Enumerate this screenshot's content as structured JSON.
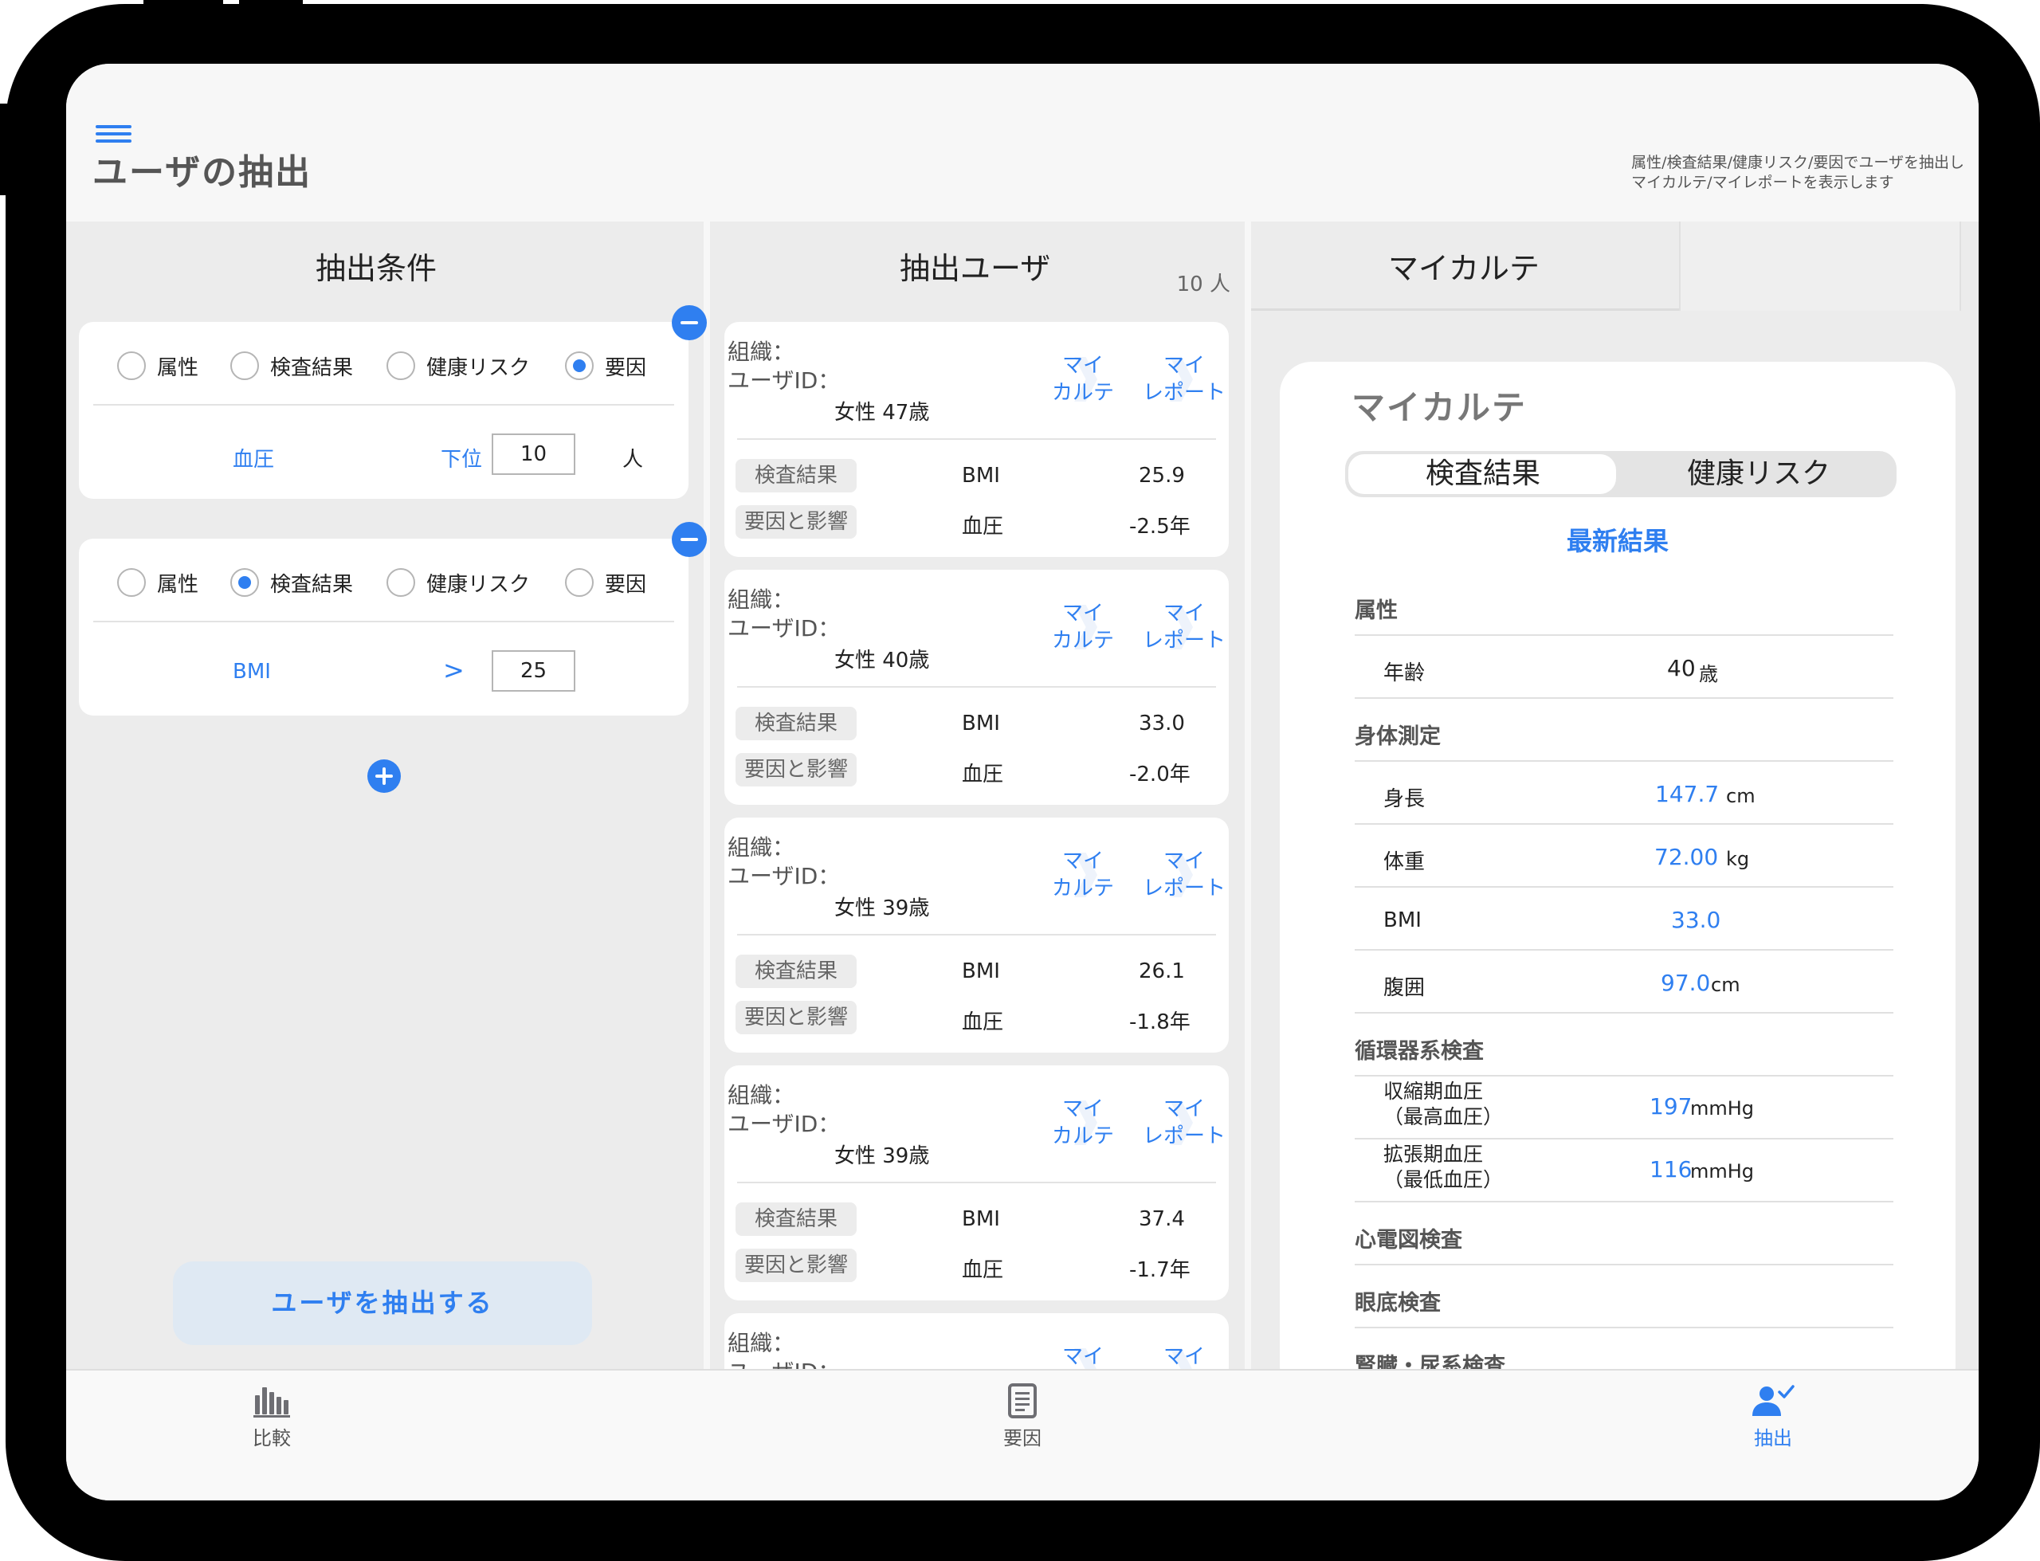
{
  "header": {
    "title": "ユーザの抽出",
    "description_line1": "属性/検査結果/健康リスク/要因でユーザを抽出し",
    "description_line2": "マイカルテ/マイレポートを表示します"
  },
  "conditions": {
    "title": "抽出条件",
    "radio_labels": [
      "属性",
      "検査結果",
      "健康リスク",
      "要因"
    ],
    "card1": {
      "selected": "要因",
      "item": "血圧",
      "operator": "下位",
      "value": "10",
      "unit": "人"
    },
    "card2": {
      "selected": "検査結果",
      "item": "BMI",
      "operator": ">",
      "value": "25"
    },
    "extract_button": "ユーザを抽出する"
  },
  "users": {
    "title": "抽出ユーザ",
    "count": "10 人",
    "org_label": "組織：",
    "id_label": "ユーザID：",
    "my_karte": [
      "マイ",
      "カルテ"
    ],
    "my_report": [
      "マイ",
      "レポート"
    ],
    "tag_result": "検査結果",
    "tag_factor": "要因と影響",
    "list": [
      {
        "attr": "女性  47歳",
        "metric": "BMI",
        "value": "25.9",
        "factor": "血圧",
        "impact": "-2.5年"
      },
      {
        "attr": "女性  40歳",
        "metric": "BMI",
        "value": "33.0",
        "factor": "血圧",
        "impact": "-2.0年"
      },
      {
        "attr": "女性  39歳",
        "metric": "BMI",
        "value": "26.1",
        "factor": "血圧",
        "impact": "-1.8年"
      },
      {
        "attr": "女性  39歳",
        "metric": "BMI",
        "value": "37.4",
        "factor": "血圧",
        "impact": "-1.7年"
      },
      {
        "attr": "",
        "metric": "",
        "value": "",
        "factor": "",
        "impact": ""
      }
    ]
  },
  "karte": {
    "tab_title": "マイカルテ",
    "card_title": "マイカルテ",
    "segments": [
      "検査結果",
      "健康リスク"
    ],
    "latest": "最新結果",
    "sections": {
      "attr": "属性",
      "body": "身体測定",
      "circ": "循環器系検査",
      "ecg": "心電図検査",
      "fundus": "眼底検査",
      "kidney": "腎臓・尿系検査"
    },
    "rows": {
      "age": {
        "label": "年齢",
        "value": "40",
        "unit": "歳"
      },
      "height": {
        "label": "身長",
        "value": "147.7",
        "unit": "cm"
      },
      "weight": {
        "label": "体重",
        "value": "72.00",
        "unit": "kg"
      },
      "bmi": {
        "label": "BMI",
        "value": "33.0",
        "unit": ""
      },
      "waist": {
        "label": "腹囲",
        "value": "97.0",
        "unit": "cm"
      },
      "sbp": {
        "label1": "収縮期血圧",
        "label2": "（最高血圧）",
        "value": "197",
        "unit": "mmHg"
      },
      "dbp": {
        "label1": "拡張期血圧",
        "label2": "（最低血圧）",
        "value": "116",
        "unit": "mmHg"
      }
    }
  },
  "nav": {
    "items": [
      {
        "label": "比較",
        "icon": "bar-chart-icon"
      },
      {
        "label": "要因",
        "icon": "document-icon"
      },
      {
        "label": "抽出",
        "icon": "person-check-icon"
      }
    ],
    "active": "抽出",
    "accent": "#2f7ff0"
  }
}
